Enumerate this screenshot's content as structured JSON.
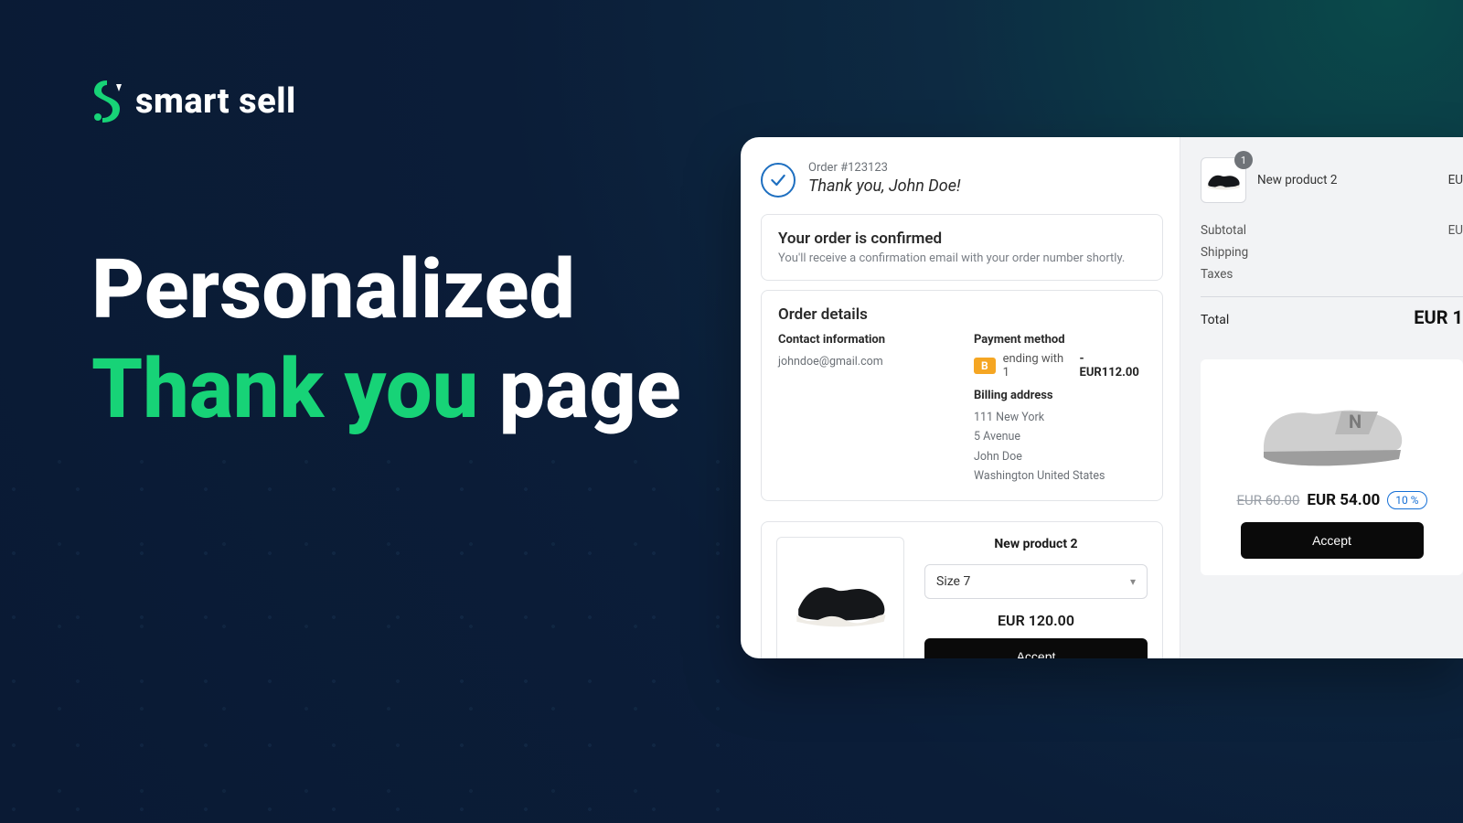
{
  "brand": {
    "name": "smart sell",
    "accent": "#17d377"
  },
  "headline": {
    "line1": "Personalized",
    "line2_accent": "Thank you",
    "line2_rest": " page"
  },
  "order": {
    "number_label": "Order #123123",
    "thank_you": "Thank you, John Doe!",
    "confirmed_title": "Your order is confirmed",
    "confirmed_sub": "You'll receive a confirmation email with your order number shortly.",
    "details_title": "Order details",
    "contact_label": "Contact information",
    "contact_email": "johndoe@gmail.com",
    "payment_label": "Payment method",
    "payment_badge": "B",
    "payment_text": "ending with 1",
    "payment_amount": "- EUR112.00",
    "billing_label": "Billing address",
    "billing_lines": {
      "l1": "111 New York",
      "l2": "5 Avenue",
      "l3": "John Doe",
      "l4": "Washington United States"
    }
  },
  "upsell_left": {
    "product_name": "New product 2",
    "size_selected": "Size 7",
    "price": "EUR 120.00",
    "accept": "Accept"
  },
  "summary": {
    "item": {
      "name": "New product 2",
      "qty": "1",
      "price": "EU"
    },
    "rows": {
      "subtotal_label": "Subtotal",
      "subtotal_value": "EU",
      "shipping_label": "Shipping",
      "taxes_label": "Taxes"
    },
    "total_label": "Total",
    "total_value": "EUR 1"
  },
  "promo": {
    "old_price": "EUR 60.00",
    "new_price": "EUR 54.00",
    "discount": "10 %",
    "accept": "Accept"
  }
}
